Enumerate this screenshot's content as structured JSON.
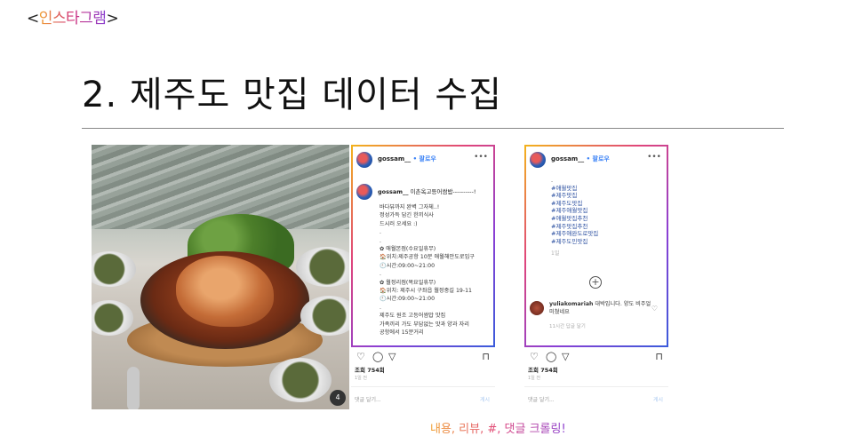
{
  "brand": {
    "open": "<",
    "name": "인스타그램",
    "close": ">"
  },
  "title": "2. 제주도 맛집 데이터 수집",
  "caption": "내용, 리뷰, #, 댓글 크롤링!",
  "photo": {
    "badge": "4"
  },
  "card1": {
    "handle": "gossam__",
    "follow": "• 팔로우",
    "more": "•••",
    "post_handle": "gossam__",
    "post_title": " 이촌옥고등어쌈밥----------!",
    "lines": [
      "바다뷰까지 완벽 그자체..!",
      "정성가득 담긴 한끼식사",
      "드시러 오세요 :)",
      ".",
      ".",
      "✿ 애월본점(수요일휴무)",
      "🏠위치:제주공항 10분 애월해안도로입구",
      "🕘시간:09:00~21:00",
      ".",
      "✿ 월정리점(목요일휴무)",
      "🏠위치: 제주시 구좌읍 월정중길 19-11",
      "🕘시간:09:00~21:00",
      ".",
      "  제주도 원조 고등어쌈밥 맛집",
      "  가족끼리 가도 부담없는 맛과 양과 자리",
      "  공항에서 15분거리"
    ],
    "likes": "조회 754회",
    "date": "1일 전",
    "comment_placeholder": "댓글 달기...",
    "post_button": "게시"
  },
  "card2": {
    "handle": "gossam__",
    "follow": "• 팔로우",
    "more": "•••",
    "dot": ".",
    "tags": [
      "#애월맛집",
      "#제주맛집",
      "#제주도맛집",
      "#제주애월맛집",
      "#애월맛집추천",
      "#제주맛집추천",
      "#제주애완도로맛집",
      "#제주도민맛집"
    ],
    "tags_time": "1일",
    "comment_user": "yuliakomariah",
    "comment_text": " 대박입니다. 양도 비주얼 미쳤네요",
    "comment_meta": "11시간   답글 달기",
    "likes": "조회 754회",
    "date": "1일 전",
    "comment_placeholder": "댓글 달기...",
    "post_button": "게시"
  }
}
